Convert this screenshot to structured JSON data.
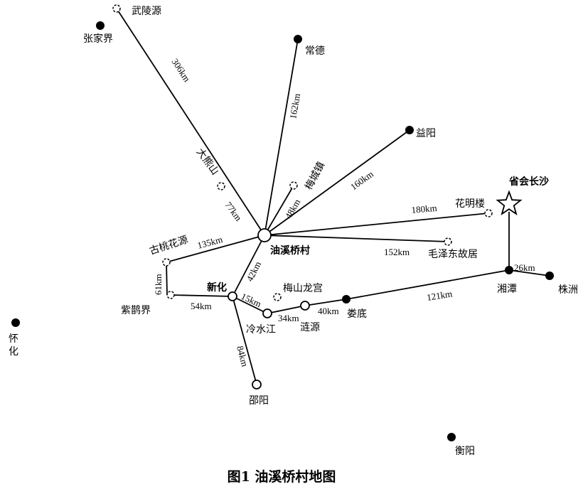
{
  "caption": "图1 油溪桥村地图",
  "places": {
    "wulingyuan": "武陵源",
    "zhangjiajie": "张家界",
    "changde": "常德",
    "yiyang": "益阳",
    "daxiongshan": "大熊山",
    "meichengzhen": "梅城镇",
    "capital_label": "省会长沙",
    "huaminglou": "花明楼",
    "youxiqiaocun": "油溪桥村",
    "maozedong": "毛泽东故居",
    "gutaohuayuan": "古桃花源",
    "xinhua": "新化",
    "meishanlonggong": "梅山龙宫",
    "xiangtan": "湘潭",
    "zhuzhou": "株洲",
    "huaihua_1": "怀",
    "huaihua_2": "化",
    "ziquejie": "紫鹊界",
    "lengshuijiang": "冷水江",
    "lianyuan": "涟源",
    "loudi": "娄底",
    "shaoyang": "邵阳",
    "hengyang": "衡阳"
  },
  "distances": {
    "wulingyuan": "306km",
    "changde": "162km",
    "yiyang": "160km",
    "meichengzhen": "48km",
    "daxiongshan": "77km",
    "huaminglou": "180km",
    "maozedong": "152km",
    "gutaohuayuan": "135km",
    "xinhua": "42km",
    "ziquejie": "61km",
    "xinhua_ziquejie": "54km",
    "lengshuijiang": "15km",
    "lianyuan": "34km",
    "loudi": "40km",
    "xiangtan": "121km",
    "zhuzhou": "26km",
    "shaoyang": "84km"
  },
  "legend_markers": {
    "filled": "city",
    "dashed": "scenic-spot",
    "hollow": "town",
    "star": "capital"
  }
}
